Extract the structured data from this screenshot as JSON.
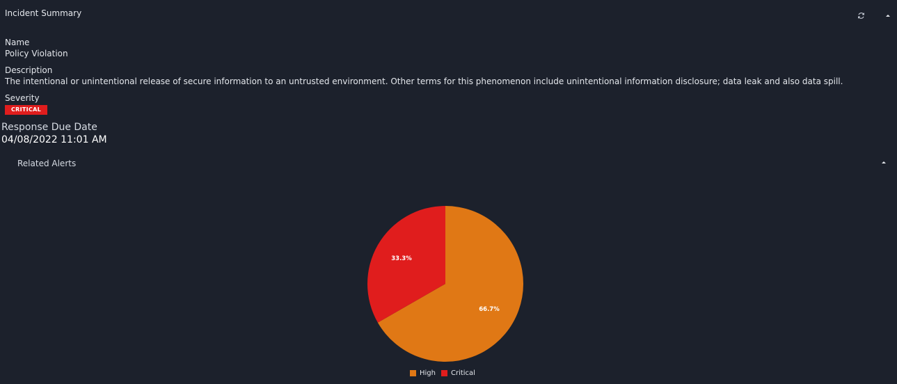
{
  "panel": {
    "title": "Incident Summary",
    "refresh_icon": "refresh-icon",
    "collapse_icon": "caret-up-icon"
  },
  "incident": {
    "name_label": "Name",
    "name_value": "Policy Violation",
    "description_label": "Description",
    "description_value": "The intentional or unintentional release of secure information to an untrusted environment. Other terms for this phenomenon include unintentional information disclosure; data leak and also data spill.",
    "severity_label": "Severity",
    "severity_value": "CRITICAL",
    "response_due_label": "Response Due Date",
    "response_due_value": "04/08/2022 11:01 AM"
  },
  "related_alerts": {
    "title": "Related Alerts",
    "collapse_icon": "caret-up-icon"
  },
  "colors": {
    "background": "#1c212c",
    "critical": "#e01d1d",
    "high": "#e07815"
  },
  "chart_data": {
    "type": "pie",
    "title": "",
    "slices": [
      {
        "name": "High",
        "value": 66.7,
        "label": "66.7%",
        "color": "#e07815"
      },
      {
        "name": "Critical",
        "value": 33.3,
        "label": "33.3%",
        "color": "#e01d1d"
      }
    ],
    "legend": "bottom"
  }
}
